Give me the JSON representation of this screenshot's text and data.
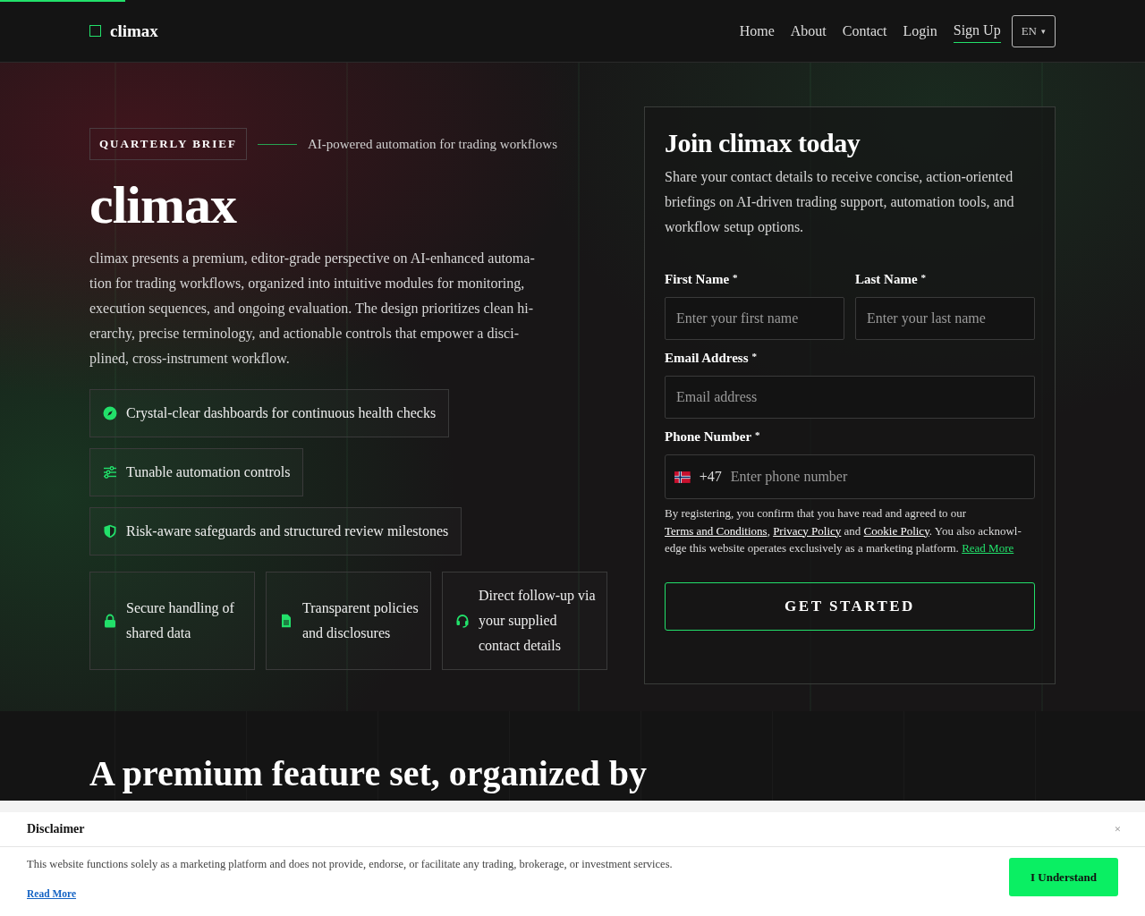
{
  "header": {
    "logo": "climax",
    "nav": [
      {
        "label": "Home",
        "selected": false
      },
      {
        "label": "About",
        "selected": false
      },
      {
        "label": "Contact",
        "selected": false
      },
      {
        "label": "Login",
        "selected": false
      },
      {
        "label": "Sign Up",
        "selected": true
      }
    ],
    "language": "EN",
    "language_caret": "▾"
  },
  "hero": {
    "badge": "QUARTERLY BRIEF",
    "tagline": "AI-powered automation for trading workflows",
    "title": "climax",
    "description_lines": [
      "climax presents a premium, editor-grade perspective on AI-enhanced automa-",
      "tion for trading workflows, organized into intuitive modules for monitoring,",
      "execution sequences, and ongoing evaluation. The design prioritizes clean hi-",
      "erarchy, precise terminology, and actionable controls that empower a disci-",
      "plined, cross-instrument workflow."
    ],
    "features": [
      {
        "text": "Crystal-clear dashboards for continuous health checks"
      },
      {
        "text": "Tunable automation controls"
      },
      {
        "text": "Risk-aware safeguards and structured review milestones"
      }
    ],
    "cards": [
      {
        "text": "Secure handling of shared data"
      },
      {
        "text": "Transparent policies and disclosures"
      },
      {
        "text": "Direct follow-up via your supplied contact details"
      }
    ]
  },
  "form": {
    "title": "Join climax today",
    "intro": "Share your contact details to receive concise, action-oriented briefings on AI-driven trading support, automation tools, and workflow setup options.",
    "fields": [
      {
        "kind": "half",
        "label": "First Name",
        "mark": "*",
        "placeholder": "Enter your first name"
      },
      {
        "kind": "half",
        "label": "Last Name",
        "mark": "*",
        "placeholder": "Enter your last name"
      },
      {
        "kind": "full",
        "label": "Email Address",
        "mark": "*",
        "placeholder": "Email address"
      },
      {
        "kind": "phone",
        "label": "Phone Number",
        "mark": "*",
        "prefix": "+47",
        "placeholder": "Enter phone number"
      }
    ],
    "legal": [
      {
        "kind": "text",
        "text": "By registering, you confirm that you have read and agreed to our "
      },
      {
        "kind": "link",
        "text": "Terms and Conditions"
      },
      {
        "kind": "text",
        "text": ", "
      },
      {
        "kind": "link",
        "text": "Privacy Policy"
      },
      {
        "kind": "text",
        "text": " and "
      },
      {
        "kind": "link",
        "text": "Cookie Policy"
      },
      {
        "kind": "text",
        "text": ". You also acknowl-edge this website operates exclusively as a marketing platform. "
      },
      {
        "kind": "accent_link",
        "text": "Read More"
      }
    ],
    "button": "GET STARTED"
  },
  "features_section": {
    "heading": "A premium feature set, organized by"
  },
  "disclaimer": {
    "title": "Disclaimer",
    "close": "×",
    "text": "This website functions solely as a marketing platform and does not provide, endorse, or facilitate any trading, brokerage, or investment services.",
    "read_more": "Read More",
    "button": "I Understand"
  }
}
